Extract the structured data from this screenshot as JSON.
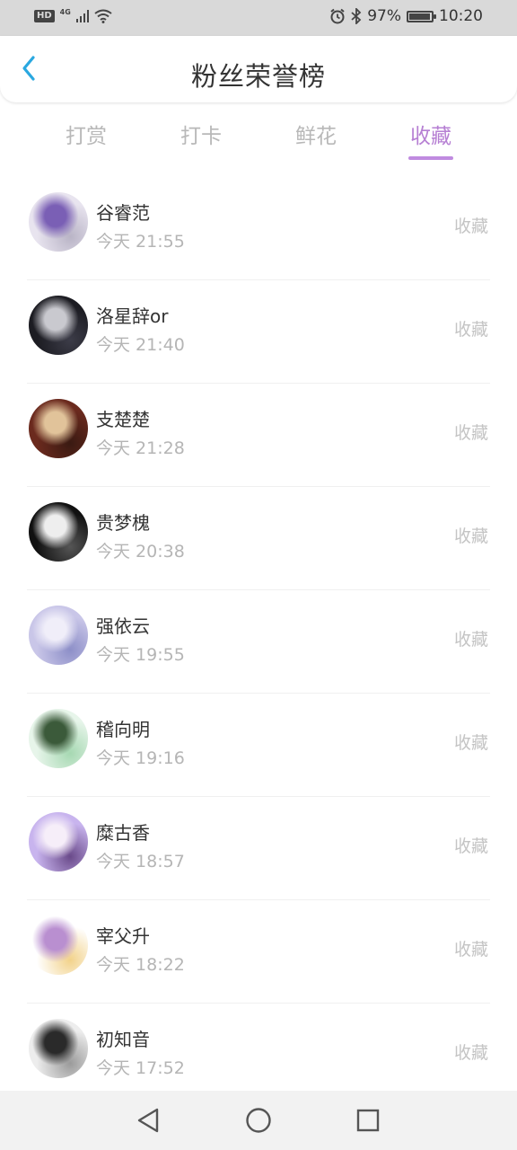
{
  "status_bar": {
    "hd": "HD",
    "network": "4G",
    "battery_percent": "97%",
    "battery_level": 0.97,
    "time": "10:20"
  },
  "header": {
    "title": "粉丝荣誉榜",
    "back_icon": "chevron-left-icon"
  },
  "tabs": [
    {
      "label": "打赏",
      "active": false
    },
    {
      "label": "打卡",
      "active": false
    },
    {
      "label": "鲜花",
      "active": false
    },
    {
      "label": "收藏",
      "active": true
    }
  ],
  "colors": {
    "accent": "#b67fd3",
    "back_icon": "#2aa8e0",
    "muted_text": "#b5b5b5"
  },
  "fans": [
    {
      "name": "谷睿范",
      "time": "今天 21:55",
      "action": "收藏",
      "avatar_colors": [
        "#e8e4ef",
        "#7a5fb5",
        "#b9b4c6"
      ]
    },
    {
      "name": "洛星辞or",
      "time": "今天 21:40",
      "action": "收藏",
      "avatar_colors": [
        "#1c1c22",
        "#c9c9cf",
        "#3c3c48"
      ]
    },
    {
      "name": "支楚楚",
      "time": "今天 21:28",
      "action": "收藏",
      "avatar_colors": [
        "#6b2a1e",
        "#e1c39a",
        "#3a1a12"
      ]
    },
    {
      "name": "贵梦槐",
      "time": "今天 20:38",
      "action": "收藏",
      "avatar_colors": [
        "#111111",
        "#eeeeee",
        "#555555"
      ]
    },
    {
      "name": "强依云",
      "time": "今天 19:55",
      "action": "收藏",
      "avatar_colors": [
        "#c9c6e8",
        "#f0eef9",
        "#8d8fc8"
      ]
    },
    {
      "name": "稽向明",
      "time": "今天 19:16",
      "action": "收藏",
      "avatar_colors": [
        "#e7f5ea",
        "#3b5a3a",
        "#a6d8b2"
      ]
    },
    {
      "name": "糜古香",
      "time": "今天 18:57",
      "action": "收藏",
      "avatar_colors": [
        "#c8b4ee",
        "#f6eef9",
        "#6a4a8a"
      ]
    },
    {
      "name": "宰父升",
      "time": "今天 18:22",
      "action": "收藏",
      "avatar_colors": [
        "#ffffff",
        "#b98fd0",
        "#f2d28a"
      ]
    },
    {
      "name": "初知音",
      "time": "今天 17:52",
      "action": "收藏",
      "avatar_colors": [
        "#ededed",
        "#2a2a2a",
        "#9a9a9a"
      ]
    }
  ],
  "nav": {
    "back": "nav-back-icon",
    "home": "nav-home-icon",
    "recents": "nav-recents-icon"
  }
}
